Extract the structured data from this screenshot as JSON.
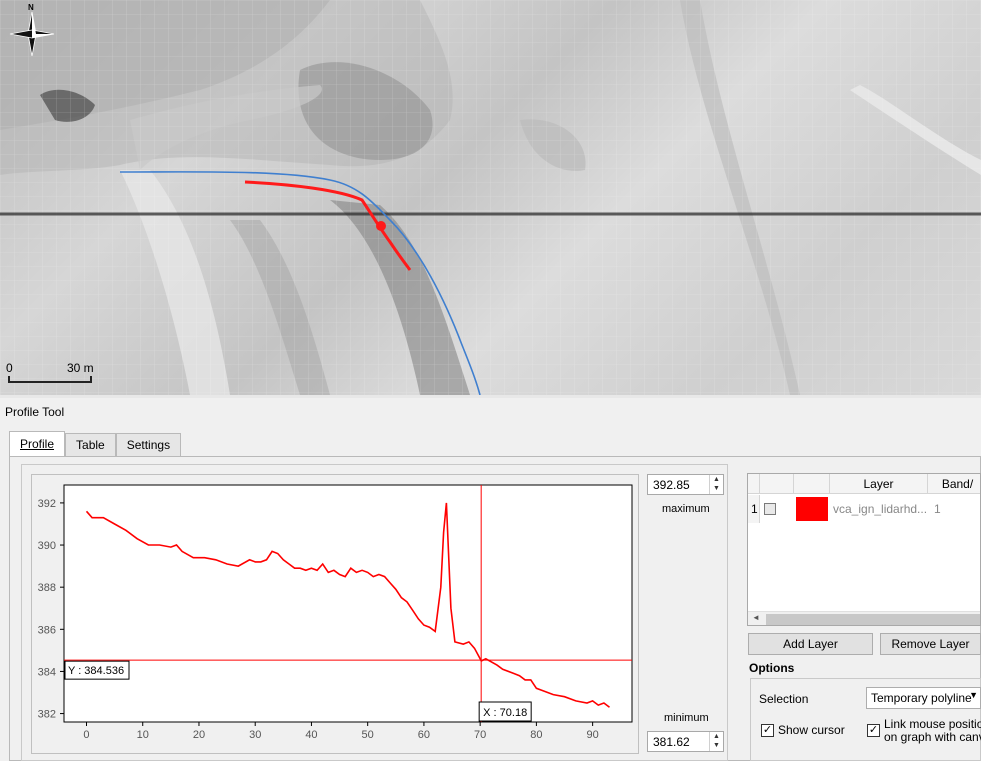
{
  "map": {
    "compass_label": "N",
    "scale_start": "0",
    "scale_end": "30 m"
  },
  "panel": {
    "title": "Profile Tool",
    "tabs": [
      {
        "label": "Profile",
        "active": true
      },
      {
        "label": "Table",
        "active": false
      },
      {
        "label": "Settings",
        "active": false
      }
    ]
  },
  "plot": {
    "maximum_value": "392.85",
    "maximum_label": "maximum",
    "minimum_value": "381.62",
    "minimum_label": "minimum",
    "cursor_y_label": "Y : 384.536",
    "cursor_x_label": "X : 70.18",
    "line_color": "#ff0000"
  },
  "chart_data": {
    "type": "line",
    "xlabel": "",
    "ylabel": "",
    "xlim": [
      -4,
      97
    ],
    "ylim": [
      381.6,
      392.85
    ],
    "xticks": [
      0,
      10,
      20,
      30,
      40,
      50,
      60,
      70,
      80,
      90
    ],
    "yticks": [
      382,
      384,
      386,
      388,
      390,
      392
    ],
    "cursor": {
      "x": 70.18,
      "y": 384.536
    },
    "series": [
      {
        "color": "#ff0000",
        "x": [
          0,
          1,
          3,
          5,
          7,
          9,
          11,
          13,
          15,
          16,
          17,
          19,
          21,
          23,
          25,
          27,
          29,
          30,
          31,
          32,
          33,
          34,
          35,
          36,
          37,
          38,
          39,
          40,
          41,
          42,
          43,
          44,
          45,
          46,
          47,
          48,
          49,
          50,
          51,
          52,
          53,
          54,
          55,
          56,
          57,
          58,
          59,
          60,
          61,
          62,
          63,
          63.5,
          64,
          64.3,
          64.8,
          65.5,
          67,
          68,
          69,
          70.2,
          71,
          73,
          74,
          76,
          77,
          78,
          79,
          80,
          81,
          83,
          85,
          87,
          89,
          90,
          91,
          92,
          93
        ],
        "y": [
          391.6,
          391.3,
          391.3,
          391.0,
          390.7,
          390.3,
          390.0,
          390.0,
          389.9,
          390.0,
          389.7,
          389.4,
          389.4,
          389.3,
          389.1,
          389.0,
          389.3,
          389.2,
          389.2,
          389.3,
          389.7,
          389.6,
          389.3,
          389.1,
          388.9,
          388.9,
          388.8,
          388.9,
          388.8,
          389.1,
          388.7,
          388.8,
          388.6,
          388.5,
          388.9,
          388.7,
          388.8,
          388.7,
          388.5,
          388.6,
          388.5,
          388.2,
          387.9,
          387.5,
          387.3,
          386.9,
          386.5,
          386.2,
          386.1,
          385.9,
          388.0,
          390.6,
          392.0,
          390.1,
          387.0,
          385.4,
          385.3,
          385.4,
          385.1,
          384.5,
          384.6,
          384.3,
          384.1,
          383.9,
          383.8,
          383.6,
          383.6,
          383.2,
          383.1,
          382.9,
          382.8,
          382.6,
          382.5,
          382.6,
          382.4,
          382.5,
          382.3
        ]
      }
    ]
  },
  "layers_table": {
    "headers": [
      "Layer",
      "Band/"
    ],
    "rows": [
      {
        "num": "1",
        "color": "#ff0000",
        "layer": "vca_ign_lidarhd...",
        "band": "1"
      }
    ]
  },
  "buttons": {
    "add_layer": "Add Layer",
    "remove_layer": "Remove Layer"
  },
  "options": {
    "title": "Options",
    "selection_label": "Selection",
    "selection_value": "Temporary polyline",
    "show_cursor": "Show cursor",
    "link_mouse_1": "Link mouse position",
    "link_mouse_2": "on graph with canva"
  }
}
